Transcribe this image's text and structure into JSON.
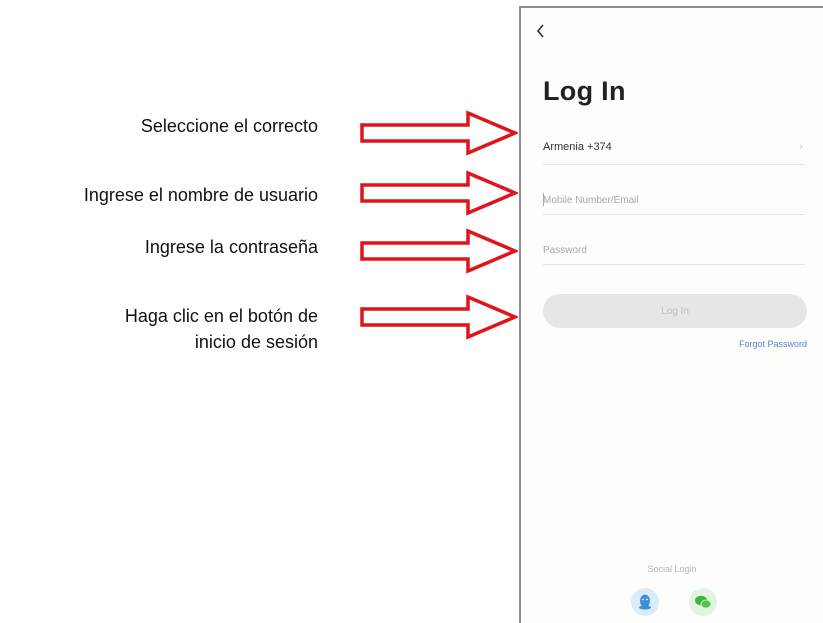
{
  "annotations": {
    "select_correct": "Seleccione el correcto",
    "enter_username": "Ingrese el nombre de usuario",
    "enter_password": "Ingrese la contraseña",
    "click_login_line1": "Haga clic en el botón de",
    "click_login_line2": "inicio de sesión"
  },
  "colors": {
    "arrow_stroke": "#e0141b",
    "login_button_bg": "#e6e6e6",
    "forgot_link": "#5a87c6"
  },
  "screen": {
    "back_icon": "chevron-left-icon",
    "title": "Log In",
    "country": {
      "label": "Armenia +374",
      "chevron": "›"
    },
    "username": {
      "value": "",
      "placeholder": "Mobile Number/Email"
    },
    "password": {
      "value": "",
      "placeholder": "Password"
    },
    "login_button": "Log In",
    "forgot_password": "Forgot Password",
    "social_login_label": "Social Login",
    "social_icons": [
      "qq-icon",
      "wechat-icon"
    ]
  }
}
